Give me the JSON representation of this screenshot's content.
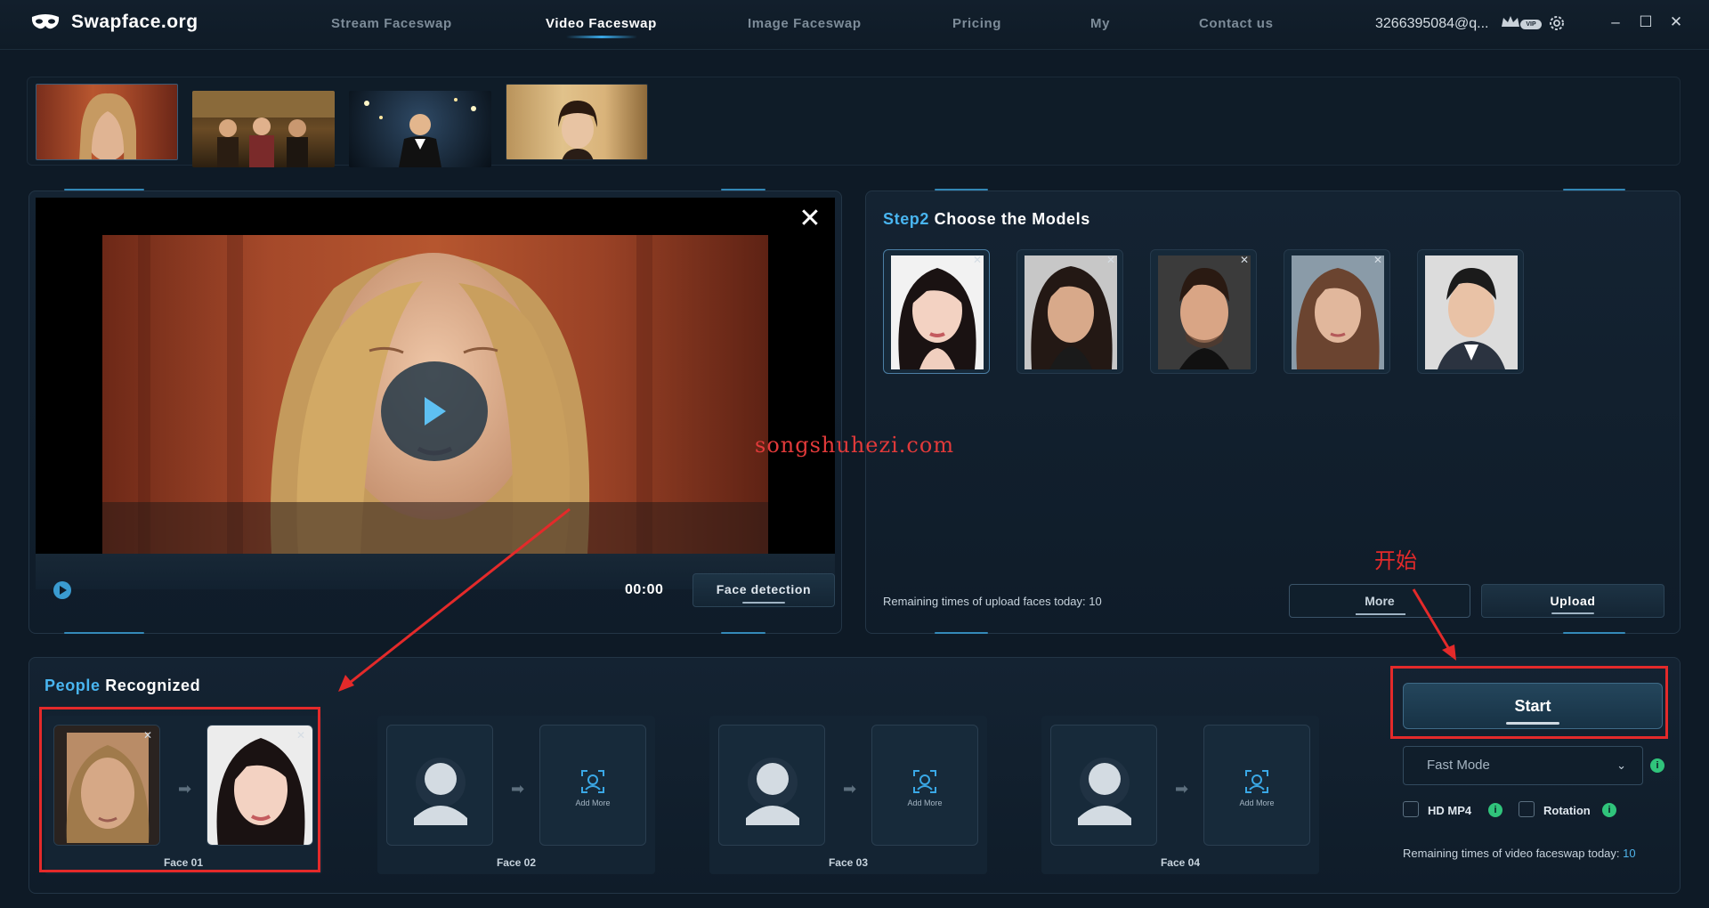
{
  "app": {
    "title": "Swapface.org"
  },
  "nav": {
    "items": [
      {
        "label": "Stream Faceswap"
      },
      {
        "label": "Video Faceswap"
      },
      {
        "label": "Image Faceswap"
      },
      {
        "label": "Pricing"
      },
      {
        "label": "My"
      },
      {
        "label": "Contact us"
      }
    ],
    "active_index": 1
  },
  "account": {
    "email": "3266395084@q...",
    "vip_label": "VIP"
  },
  "window_controls": {
    "minimize": "–",
    "maximize": "☐",
    "close": "✕"
  },
  "video": {
    "time": "00:00",
    "face_detection_label": "Face detection",
    "close_glyph": "✕"
  },
  "step2": {
    "step_label": "Step2",
    "title": "Choose the Models",
    "remaining_upload_text": "Remaining times of upload faces today: 10",
    "more_label": "More",
    "upload_label": "Upload"
  },
  "people": {
    "heading_highlight": "People",
    "heading_rest": "Recognized",
    "add_more_label": "Add More",
    "faces": [
      {
        "label": "Face 01"
      },
      {
        "label": "Face 02"
      },
      {
        "label": "Face 03"
      },
      {
        "label": "Face 04"
      }
    ]
  },
  "controls": {
    "start_label": "Start",
    "mode_value": "Fast Mode",
    "hd_label": "HD MP4",
    "rotation_label": "Rotation",
    "remaining_video_text": "Remaining times of video faceswap today:",
    "remaining_video_count": "10"
  },
  "annotations": {
    "start_cn": "开始",
    "watermark": "songshuhezi.com"
  },
  "colors": {
    "accent": "#3a9bd0",
    "highlight": "#e42a2a",
    "success": "#30c47b",
    "background": "#0e1a26"
  }
}
